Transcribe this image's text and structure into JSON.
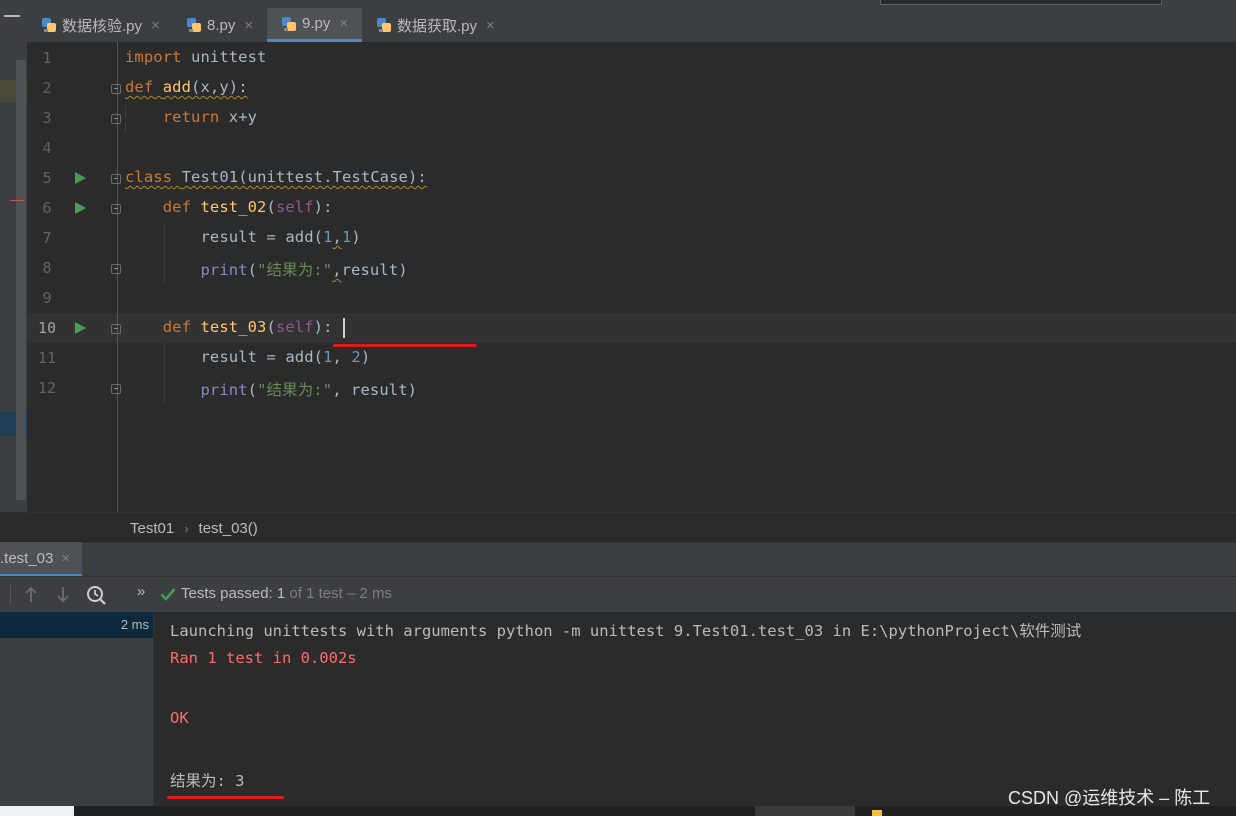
{
  "tabs": [
    {
      "label": "数据核验.py",
      "active": false
    },
    {
      "label": "8.py",
      "active": false
    },
    {
      "label": "9.py",
      "active": true
    },
    {
      "label": "数据获取.py",
      "active": false
    }
  ],
  "close_glyph": "×",
  "editor": {
    "line_numbers": [
      "1",
      "2",
      "3",
      "4",
      "5",
      "6",
      "7",
      "8",
      "9",
      "10",
      "11",
      "12"
    ],
    "lines": {
      "l1": {
        "kw": "import",
        "rest": " unittest"
      },
      "l2": {
        "kw": "def",
        "name": "add",
        "params": "(x,y):"
      },
      "l3": {
        "kw": "return",
        "rest": " x+y"
      },
      "l5": {
        "kw": "class",
        "name": "Test01",
        "rest": "(unittest.TestCase):"
      },
      "l6": {
        "kw": "def",
        "name": "test_02",
        "open": "(",
        "self": "self",
        "close": "):"
      },
      "l7": {
        "a": "result = add(",
        "n1": "1",
        "b": ",",
        "n2": "1",
        "c": ")"
      },
      "l8": {
        "fn": "print",
        "a": "(",
        "str": "\"结果为:\"",
        "b": ",",
        "c": "result)"
      },
      "l10": {
        "kw": "def",
        "name": "test_03",
        "open": "(",
        "self": "self",
        "close": "):"
      },
      "l11": {
        "a": "result = add(",
        "n1": "1",
        "b": ", ",
        "n2": "2",
        "c": ")"
      },
      "l12": {
        "fn": "print",
        "a": "(",
        "str": "\"结果为:\"",
        "b": ", result)"
      }
    }
  },
  "breadcrumb": {
    "class": "Test01",
    "method": "test_03()",
    "sep": "›"
  },
  "run": {
    "tab_label": ".test_03",
    "tests_passed_label": "Tests passed:",
    "tests_passed_count": "1",
    "tests_passed_detail": "of 1 test – 2 ms",
    "chevrons": "»",
    "result_time": "2 ms",
    "console": [
      "Launching unittests with arguments python -m unittest 9.Test01.test_03 in E:\\pythonProject\\软件测试",
      "Ran 1 test in 0.002s",
      "OK",
      "结果为: 3"
    ]
  },
  "watermark": "CSDN @运维技术 – 陈工",
  "colors": {
    "keyword": "#cc7832",
    "function": "#ffc66d",
    "string": "#6a8759",
    "number": "#6897bb",
    "self": "#94558d",
    "error_text": "#ff6b68",
    "pass": "#499c54",
    "accent": "#4a88c7",
    "annotation_red": "#e01b1b"
  }
}
